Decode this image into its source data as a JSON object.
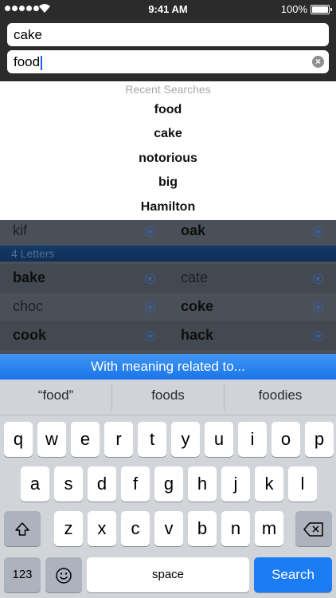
{
  "status": {
    "time": "9:41 AM",
    "battery": "100%"
  },
  "search": {
    "field1": "cake",
    "field2": "food"
  },
  "recent": {
    "title": "Recent Searches",
    "items": [
      "food",
      "cake",
      "notorious",
      "big",
      "Hamilton"
    ]
  },
  "grid": {
    "top_row": {
      "left": "kif",
      "right": "oak"
    },
    "section_header": "4 Letters",
    "rows": [
      {
        "left": "bake",
        "right": "cate"
      },
      {
        "left": "choc",
        "right": "coke"
      },
      {
        "left": "cook",
        "right": "hack"
      }
    ]
  },
  "meaning_bar": "With meaning related to...",
  "suggestions": [
    "“food”",
    "foods",
    "foodies"
  ],
  "keyboard": {
    "row1": [
      "q",
      "w",
      "e",
      "r",
      "t",
      "y",
      "u",
      "i",
      "o",
      "p"
    ],
    "row2": [
      "a",
      "s",
      "d",
      "f",
      "g",
      "h",
      "j",
      "k",
      "l"
    ],
    "row3": [
      "z",
      "x",
      "c",
      "v",
      "b",
      "n",
      "m"
    ],
    "numbers": "123",
    "space": "space",
    "search": "Search",
    "shift_icon": "shift-icon",
    "delete_icon": "delete-icon",
    "emoji_icon": "emoji-icon"
  }
}
